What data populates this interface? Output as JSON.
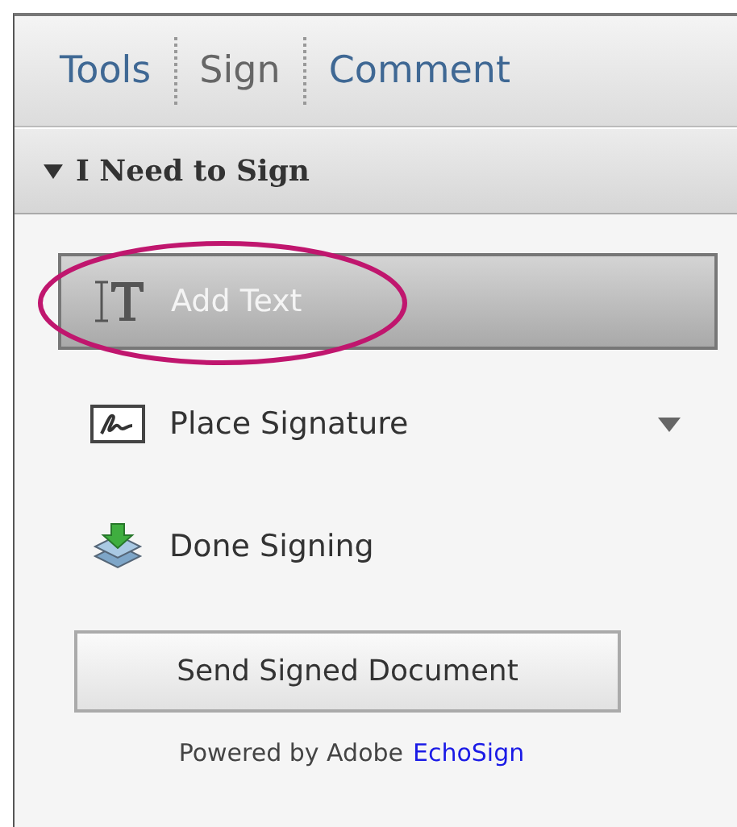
{
  "tabs": [
    {
      "label": "Tools",
      "selected": false
    },
    {
      "label": "Sign",
      "selected": true
    },
    {
      "label": "Comment",
      "selected": false
    }
  ],
  "panel": {
    "title": "I Need to Sign",
    "expanded": true,
    "items": [
      {
        "kind": "text",
        "label": "Add Text",
        "selected": true,
        "circled": true,
        "has_menu": false
      },
      {
        "kind": "signature",
        "label": "Place Signature",
        "selected": false,
        "circled": false,
        "has_menu": true
      },
      {
        "kind": "done",
        "label": "Done Signing",
        "selected": false,
        "circled": false,
        "has_menu": false
      }
    ],
    "send_button": "Send Signed Document",
    "footer": {
      "text": "Powered by Adobe",
      "link": "EchoSign"
    }
  }
}
